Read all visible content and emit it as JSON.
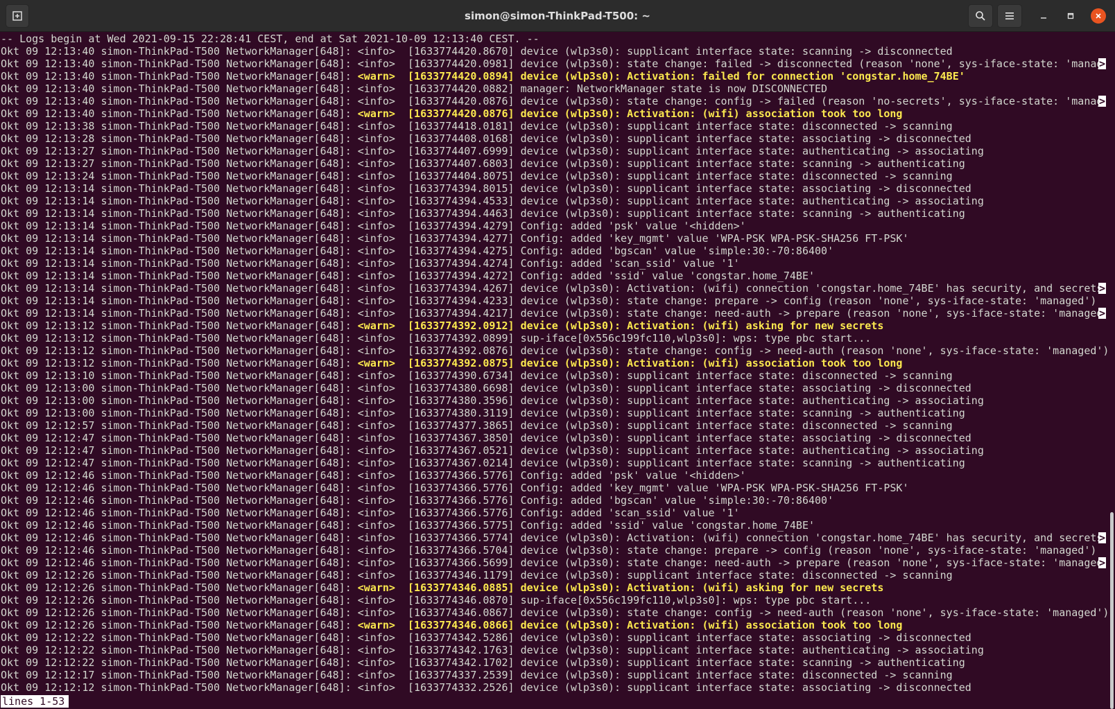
{
  "window": {
    "title": "simon@simon-ThinkPad-T500: ~"
  },
  "icons": {
    "new_tab": "new-tab-icon",
    "search": "search-icon",
    "menu": "hamburger-menu-icon",
    "minimize": "minimize-icon",
    "maximize": "maximize-icon",
    "close": "close-icon"
  },
  "colors": {
    "terminal_bg": "#300a24",
    "text": "#d3d7cf",
    "warn": "#fce94f",
    "close": "#e95420"
  },
  "terminal": {
    "header": "-- Logs begin at Wed 2021-09-15 22:28:41 CEST, end at Sat 2021-10-09 12:13:40 CEST. --",
    "truncation_marker": ">",
    "status": "lines 1-53",
    "lines": [
      {
        "prefix": "Okt 09 12:13:40 simon-ThinkPad-T500 NetworkManager[648]: ",
        "level": "<info>",
        "message": "[1633774420.8670] device (wlp3s0): supplicant interface state: scanning -> disconnected",
        "warn": false,
        "truncated": false
      },
      {
        "prefix": "Okt 09 12:13:40 simon-ThinkPad-T500 NetworkManager[648]: ",
        "level": "<info>",
        "message": "[1633774420.0981] device (wlp3s0): state change: failed -> disconnected (reason 'none', sys-iface-state: 'manag",
        "warn": false,
        "truncated": true
      },
      {
        "prefix": "Okt 09 12:13:40 simon-ThinkPad-T500 NetworkManager[648]: ",
        "level": "<warn>",
        "message": "[1633774420.0894] device (wlp3s0): Activation: failed for connection 'congstar.home_74BE'",
        "warn": true,
        "truncated": false
      },
      {
        "prefix": "Okt 09 12:13:40 simon-ThinkPad-T500 NetworkManager[648]: ",
        "level": "<info>",
        "message": "[1633774420.0882] manager: NetworkManager state is now DISCONNECTED",
        "warn": false,
        "truncated": false
      },
      {
        "prefix": "Okt 09 12:13:40 simon-ThinkPad-T500 NetworkManager[648]: ",
        "level": "<info>",
        "message": "[1633774420.0876] device (wlp3s0): state change: config -> failed (reason 'no-secrets', sys-iface-state: 'manag",
        "warn": false,
        "truncated": true
      },
      {
        "prefix": "Okt 09 12:13:40 simon-ThinkPad-T500 NetworkManager[648]: ",
        "level": "<warn>",
        "message": "[1633774420.0876] device (wlp3s0): Activation: (wifi) association took too long",
        "warn": true,
        "truncated": false
      },
      {
        "prefix": "Okt 09 12:13:38 simon-ThinkPad-T500 NetworkManager[648]: ",
        "level": "<info>",
        "message": "[1633774418.0181] device (wlp3s0): supplicant interface state: disconnected -> scanning",
        "warn": false,
        "truncated": false
      },
      {
        "prefix": "Okt 09 12:13:28 simon-ThinkPad-T500 NetworkManager[648]: ",
        "level": "<info>",
        "message": "[1633774408.0168] device (wlp3s0): supplicant interface state: associating -> disconnected",
        "warn": false,
        "truncated": false
      },
      {
        "prefix": "Okt 09 12:13:27 simon-ThinkPad-T500 NetworkManager[648]: ",
        "level": "<info>",
        "message": "[1633774407.6999] device (wlp3s0): supplicant interface state: authenticating -> associating",
        "warn": false,
        "truncated": false
      },
      {
        "prefix": "Okt 09 12:13:27 simon-ThinkPad-T500 NetworkManager[648]: ",
        "level": "<info>",
        "message": "[1633774407.6803] device (wlp3s0): supplicant interface state: scanning -> authenticating",
        "warn": false,
        "truncated": false
      },
      {
        "prefix": "Okt 09 12:13:24 simon-ThinkPad-T500 NetworkManager[648]: ",
        "level": "<info>",
        "message": "[1633774404.8075] device (wlp3s0): supplicant interface state: disconnected -> scanning",
        "warn": false,
        "truncated": false
      },
      {
        "prefix": "Okt 09 12:13:14 simon-ThinkPad-T500 NetworkManager[648]: ",
        "level": "<info>",
        "message": "[1633774394.8015] device (wlp3s0): supplicant interface state: associating -> disconnected",
        "warn": false,
        "truncated": false
      },
      {
        "prefix": "Okt 09 12:13:14 simon-ThinkPad-T500 NetworkManager[648]: ",
        "level": "<info>",
        "message": "[1633774394.4533] device (wlp3s0): supplicant interface state: authenticating -> associating",
        "warn": false,
        "truncated": false
      },
      {
        "prefix": "Okt 09 12:13:14 simon-ThinkPad-T500 NetworkManager[648]: ",
        "level": "<info>",
        "message": "[1633774394.4463] device (wlp3s0): supplicant interface state: scanning -> authenticating",
        "warn": false,
        "truncated": false
      },
      {
        "prefix": "Okt 09 12:13:14 simon-ThinkPad-T500 NetworkManager[648]: ",
        "level": "<info>",
        "message": "[1633774394.4279] Config: added 'psk' value '<hidden>'",
        "warn": false,
        "truncated": false
      },
      {
        "prefix": "Okt 09 12:13:14 simon-ThinkPad-T500 NetworkManager[648]: ",
        "level": "<info>",
        "message": "[1633774394.4277] Config: added 'key_mgmt' value 'WPA-PSK WPA-PSK-SHA256 FT-PSK'",
        "warn": false,
        "truncated": false
      },
      {
        "prefix": "Okt 09 12:13:14 simon-ThinkPad-T500 NetworkManager[648]: ",
        "level": "<info>",
        "message": "[1633774394.4275] Config: added 'bgscan' value 'simple:30:-70:86400'",
        "warn": false,
        "truncated": false
      },
      {
        "prefix": "Okt 09 12:13:14 simon-ThinkPad-T500 NetworkManager[648]: ",
        "level": "<info>",
        "message": "[1633774394.4274] Config: added 'scan_ssid' value '1'",
        "warn": false,
        "truncated": false
      },
      {
        "prefix": "Okt 09 12:13:14 simon-ThinkPad-T500 NetworkManager[648]: ",
        "level": "<info>",
        "message": "[1633774394.4272] Config: added 'ssid' value 'congstar.home_74BE'",
        "warn": false,
        "truncated": false
      },
      {
        "prefix": "Okt 09 12:13:14 simon-ThinkPad-T500 NetworkManager[648]: ",
        "level": "<info>",
        "message": "[1633774394.4267] device (wlp3s0): Activation: (wifi) connection 'congstar.home_74BE' has security, and secrets",
        "warn": false,
        "truncated": true
      },
      {
        "prefix": "Okt 09 12:13:14 simon-ThinkPad-T500 NetworkManager[648]: ",
        "level": "<info>",
        "message": "[1633774394.4233] device (wlp3s0): state change: prepare -> config (reason 'none', sys-iface-state: 'managed')",
        "warn": false,
        "truncated": false
      },
      {
        "prefix": "Okt 09 12:13:14 simon-ThinkPad-T500 NetworkManager[648]: ",
        "level": "<info>",
        "message": "[1633774394.4217] device (wlp3s0): state change: need-auth -> prepare (reason 'none', sys-iface-state: 'managed",
        "warn": false,
        "truncated": true
      },
      {
        "prefix": "Okt 09 12:13:12 simon-ThinkPad-T500 NetworkManager[648]: ",
        "level": "<warn>",
        "message": "[1633774392.0912] device (wlp3s0): Activation: (wifi) asking for new secrets",
        "warn": true,
        "truncated": false
      },
      {
        "prefix": "Okt 09 12:13:12 simon-ThinkPad-T500 NetworkManager[648]: ",
        "level": "<info>",
        "message": "[1633774392.0899] sup-iface[0x556c199fc110,wlp3s0]: wps: type pbc start...",
        "warn": false,
        "truncated": false
      },
      {
        "prefix": "Okt 09 12:13:12 simon-ThinkPad-T500 NetworkManager[648]: ",
        "level": "<info>",
        "message": "[1633774392.0876] device (wlp3s0): state change: config -> need-auth (reason 'none', sys-iface-state: 'managed')",
        "warn": false,
        "truncated": false
      },
      {
        "prefix": "Okt 09 12:13:12 simon-ThinkPad-T500 NetworkManager[648]: ",
        "level": "<warn>",
        "message": "[1633774392.0875] device (wlp3s0): Activation: (wifi) association took too long",
        "warn": true,
        "truncated": false
      },
      {
        "prefix": "Okt 09 12:13:10 simon-ThinkPad-T500 NetworkManager[648]: ",
        "level": "<info>",
        "message": "[1633774390.6734] device (wlp3s0): supplicant interface state: disconnected -> scanning",
        "warn": false,
        "truncated": false
      },
      {
        "prefix": "Okt 09 12:13:00 simon-ThinkPad-T500 NetworkManager[648]: ",
        "level": "<info>",
        "message": "[1633774380.6698] device (wlp3s0): supplicant interface state: associating -> disconnected",
        "warn": false,
        "truncated": false
      },
      {
        "prefix": "Okt 09 12:13:00 simon-ThinkPad-T500 NetworkManager[648]: ",
        "level": "<info>",
        "message": "[1633774380.3596] device (wlp3s0): supplicant interface state: authenticating -> associating",
        "warn": false,
        "truncated": false
      },
      {
        "prefix": "Okt 09 12:13:00 simon-ThinkPad-T500 NetworkManager[648]: ",
        "level": "<info>",
        "message": "[1633774380.3119] device (wlp3s0): supplicant interface state: scanning -> authenticating",
        "warn": false,
        "truncated": false
      },
      {
        "prefix": "Okt 09 12:12:57 simon-ThinkPad-T500 NetworkManager[648]: ",
        "level": "<info>",
        "message": "[1633774377.3865] device (wlp3s0): supplicant interface state: disconnected -> scanning",
        "warn": false,
        "truncated": false
      },
      {
        "prefix": "Okt 09 12:12:47 simon-ThinkPad-T500 NetworkManager[648]: ",
        "level": "<info>",
        "message": "[1633774367.3850] device (wlp3s0): supplicant interface state: associating -> disconnected",
        "warn": false,
        "truncated": false
      },
      {
        "prefix": "Okt 09 12:12:47 simon-ThinkPad-T500 NetworkManager[648]: ",
        "level": "<info>",
        "message": "[1633774367.0521] device (wlp3s0): supplicant interface state: authenticating -> associating",
        "warn": false,
        "truncated": false
      },
      {
        "prefix": "Okt 09 12:12:47 simon-ThinkPad-T500 NetworkManager[648]: ",
        "level": "<info>",
        "message": "[1633774367.0214] device (wlp3s0): supplicant interface state: scanning -> authenticating",
        "warn": false,
        "truncated": false
      },
      {
        "prefix": "Okt 09 12:12:46 simon-ThinkPad-T500 NetworkManager[648]: ",
        "level": "<info>",
        "message": "[1633774366.5776] Config: added 'psk' value '<hidden>'",
        "warn": false,
        "truncated": false
      },
      {
        "prefix": "Okt 09 12:12:46 simon-ThinkPad-T500 NetworkManager[648]: ",
        "level": "<info>",
        "message": "[1633774366.5776] Config: added 'key_mgmt' value 'WPA-PSK WPA-PSK-SHA256 FT-PSK'",
        "warn": false,
        "truncated": false
      },
      {
        "prefix": "Okt 09 12:12:46 simon-ThinkPad-T500 NetworkManager[648]: ",
        "level": "<info>",
        "message": "[1633774366.5776] Config: added 'bgscan' value 'simple:30:-70:86400'",
        "warn": false,
        "truncated": false
      },
      {
        "prefix": "Okt 09 12:12:46 simon-ThinkPad-T500 NetworkManager[648]: ",
        "level": "<info>",
        "message": "[1633774366.5776] Config: added 'scan_ssid' value '1'",
        "warn": false,
        "truncated": false
      },
      {
        "prefix": "Okt 09 12:12:46 simon-ThinkPad-T500 NetworkManager[648]: ",
        "level": "<info>",
        "message": "[1633774366.5775] Config: added 'ssid' value 'congstar.home_74BE'",
        "warn": false,
        "truncated": false
      },
      {
        "prefix": "Okt 09 12:12:46 simon-ThinkPad-T500 NetworkManager[648]: ",
        "level": "<info>",
        "message": "[1633774366.5774] device (wlp3s0): Activation: (wifi) connection 'congstar.home_74BE' has security, and secrets",
        "warn": false,
        "truncated": true
      },
      {
        "prefix": "Okt 09 12:12:46 simon-ThinkPad-T500 NetworkManager[648]: ",
        "level": "<info>",
        "message": "[1633774366.5704] device (wlp3s0): state change: prepare -> config (reason 'none', sys-iface-state: 'managed')",
        "warn": false,
        "truncated": false
      },
      {
        "prefix": "Okt 09 12:12:46 simon-ThinkPad-T500 NetworkManager[648]: ",
        "level": "<info>",
        "message": "[1633774366.5699] device (wlp3s0): state change: need-auth -> prepare (reason 'none', sys-iface-state: 'managed",
        "warn": false,
        "truncated": true
      },
      {
        "prefix": "Okt 09 12:12:26 simon-ThinkPad-T500 NetworkManager[648]: ",
        "level": "<info>",
        "message": "[1633774346.1179] device (wlp3s0): supplicant interface state: disconnected -> scanning",
        "warn": false,
        "truncated": false
      },
      {
        "prefix": "Okt 09 12:12:26 simon-ThinkPad-T500 NetworkManager[648]: ",
        "level": "<warn>",
        "message": "[1633774346.0885] device (wlp3s0): Activation: (wifi) asking for new secrets",
        "warn": true,
        "truncated": false
      },
      {
        "prefix": "Okt 09 12:12:26 simon-ThinkPad-T500 NetworkManager[648]: ",
        "level": "<info>",
        "message": "[1633774346.0870] sup-iface[0x556c199fc110,wlp3s0]: wps: type pbc start...",
        "warn": false,
        "truncated": false
      },
      {
        "prefix": "Okt 09 12:12:26 simon-ThinkPad-T500 NetworkManager[648]: ",
        "level": "<info>",
        "message": "[1633774346.0867] device (wlp3s0): state change: config -> need-auth (reason 'none', sys-iface-state: 'managed')",
        "warn": false,
        "truncated": false
      },
      {
        "prefix": "Okt 09 12:12:26 simon-ThinkPad-T500 NetworkManager[648]: ",
        "level": "<warn>",
        "message": "[1633774346.0866] device (wlp3s0): Activation: (wifi) association took too long",
        "warn": true,
        "truncated": false
      },
      {
        "prefix": "Okt 09 12:12:22 simon-ThinkPad-T500 NetworkManager[648]: ",
        "level": "<info>",
        "message": "[1633774342.5286] device (wlp3s0): supplicant interface state: associating -> disconnected",
        "warn": false,
        "truncated": false
      },
      {
        "prefix": "Okt 09 12:12:22 simon-ThinkPad-T500 NetworkManager[648]: ",
        "level": "<info>",
        "message": "[1633774342.1763] device (wlp3s0): supplicant interface state: authenticating -> associating",
        "warn": false,
        "truncated": false
      },
      {
        "prefix": "Okt 09 12:12:22 simon-ThinkPad-T500 NetworkManager[648]: ",
        "level": "<info>",
        "message": "[1633774342.1702] device (wlp3s0): supplicant interface state: scanning -> authenticating",
        "warn": false,
        "truncated": false
      },
      {
        "prefix": "Okt 09 12:12:17 simon-ThinkPad-T500 NetworkManager[648]: ",
        "level": "<info>",
        "message": "[1633774337.2539] device (wlp3s0): supplicant interface state: disconnected -> scanning",
        "warn": false,
        "truncated": false
      },
      {
        "prefix": "Okt 09 12:12:12 simon-ThinkPad-T500 NetworkManager[648]: ",
        "level": "<info>",
        "message": "[1633774332.2526] device (wlp3s0): supplicant interface state: associating -> disconnected",
        "warn": false,
        "truncated": false
      }
    ]
  }
}
